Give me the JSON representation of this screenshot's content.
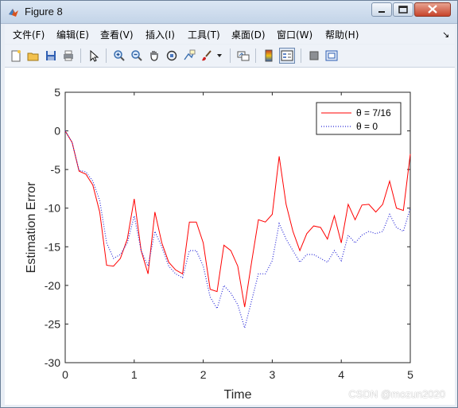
{
  "window": {
    "title": "Figure 8"
  },
  "menu": {
    "items": [
      "文件(F)",
      "编辑(E)",
      "查看(V)",
      "插入(I)",
      "工具(T)",
      "桌面(D)",
      "窗口(W)",
      "帮助(H)"
    ],
    "overflow_arrow": "↘"
  },
  "toolbar": {
    "icons": [
      "new-figure-icon",
      "open-file-icon",
      "save-icon",
      "print-icon",
      "arrow-pointer-icon",
      "zoom-in-icon",
      "zoom-out-icon",
      "pan-hand-icon",
      "rotate-3d-icon",
      "data-cursor-icon",
      "brush-icon",
      "brush-dropdown-icon",
      "link-plot-icon",
      "colorbar-icon",
      "legend-icon",
      "hide-plot-tools-icon",
      "show-plot-tools-icon"
    ]
  },
  "chart_data": {
    "type": "line",
    "xlabel": "Time",
    "ylabel": "Estimation Error",
    "xlim": [
      0,
      5
    ],
    "ylim": [
      -30,
      5
    ],
    "xticks": [
      0,
      1,
      2,
      3,
      4,
      5
    ],
    "yticks": [
      5,
      0,
      -5,
      -10,
      -15,
      -20,
      -25,
      -30
    ],
    "grid": false,
    "legend_position": "top-right",
    "x": [
      0,
      0.1,
      0.2,
      0.3,
      0.4,
      0.5,
      0.6,
      0.7,
      0.8,
      0.9,
      1.0,
      1.1,
      1.2,
      1.3,
      1.4,
      1.5,
      1.6,
      1.7,
      1.8,
      1.9,
      2.0,
      2.1,
      2.2,
      2.3,
      2.4,
      2.5,
      2.6,
      2.7,
      2.8,
      2.9,
      3.0,
      3.1,
      3.2,
      3.3,
      3.4,
      3.5,
      3.6,
      3.7,
      3.8,
      3.9,
      4.0,
      4.1,
      4.2,
      4.3,
      4.4,
      4.5,
      4.6,
      4.7,
      4.8,
      4.9,
      5.0
    ],
    "series": [
      {
        "name": "θ = 7/16",
        "color": "#ff0000",
        "style": "solid",
        "values": [
          0,
          -1.5,
          -5.2,
          -5.6,
          -7,
          -10.5,
          -17.4,
          -17.5,
          -16.5,
          -14,
          -8.8,
          -15.5,
          -18.5,
          -10.5,
          -14.5,
          -17,
          -18,
          -18.5,
          -11.8,
          -11.8,
          -14.5,
          -20.5,
          -20.8,
          -14.8,
          -15.5,
          -17.5,
          -22.8,
          -17,
          -11.5,
          -11.8,
          -10.8,
          -3.3,
          -9.5,
          -13,
          -15.5,
          -13.3,
          -12.3,
          -12.5,
          -14,
          -11,
          -14.5,
          -9.5,
          -11.5,
          -9.6,
          -9.5,
          -10.5,
          -9.5,
          -6.5,
          -10,
          -10.3,
          -3
        ]
      },
      {
        "name": "θ = 0",
        "color": "#2a2ad8",
        "style": "dotted",
        "values": [
          0,
          -1.5,
          -5.1,
          -5.3,
          -6.5,
          -9,
          -14.5,
          -16.5,
          -16,
          -14.5,
          -11,
          -15.5,
          -17.5,
          -13,
          -15,
          -17.5,
          -18.5,
          -19,
          -15.5,
          -15.5,
          -17.5,
          -21.5,
          -23,
          -20,
          -21,
          -22.5,
          -25.5,
          -22,
          -18.5,
          -18.5,
          -16.8,
          -12,
          -14,
          -15.5,
          -17,
          -16,
          -16,
          -16.5,
          -17,
          -15.5,
          -16.8,
          -13.5,
          -14.5,
          -13.5,
          -13,
          -13.3,
          -13,
          -10.8,
          -12.5,
          -13,
          -10
        ]
      }
    ]
  },
  "watermark": "CSDN @mozun2020"
}
